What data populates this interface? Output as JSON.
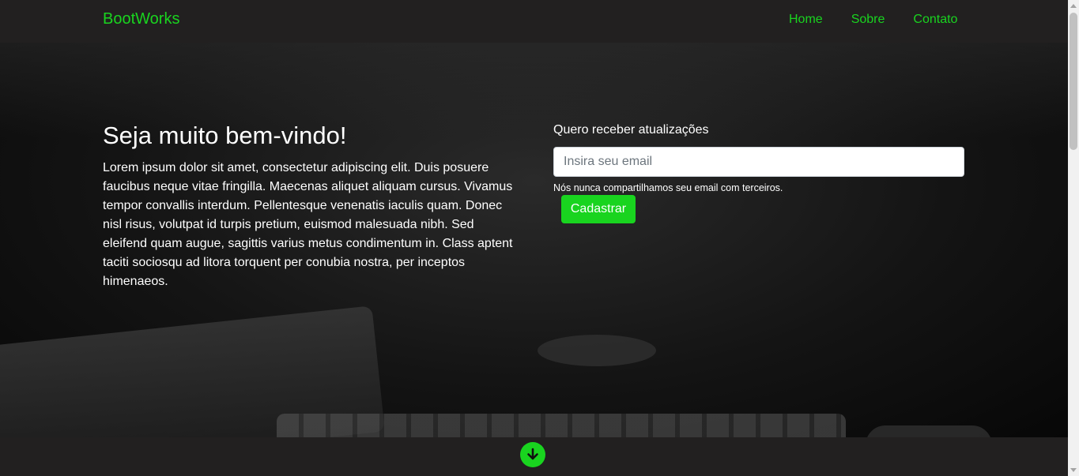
{
  "navbar": {
    "brand": "BootWorks",
    "links": [
      "Home",
      "Sobre",
      "Contato"
    ]
  },
  "hero": {
    "title": "Seja muito bem-vindo!",
    "text": "Lorem ipsum dolor sit amet, consectetur adipiscing elit. Duis posuere faucibus neque vitae fringilla. Maecenas aliquet aliquam cursus. Vivamus tempor convallis interdum. Pellentesque venenatis iaculis quam. Donec nisl risus, volutpat id turpis pretium, euismod malesuada nibh. Sed eleifend quam augue, sagittis varius metus condimentum in. Class aptent taciti sociosqu ad litora torquent per conubia nostra, per inceptos himenaeos."
  },
  "form": {
    "label": "Quero receber atualizações",
    "email_placeholder": "Insira seu email",
    "email_value": "",
    "help": "Nós nunca compartilhamos seu email com terceiros.",
    "submit_label": "Cadastrar"
  },
  "footer": {
    "icon": "arrow-down-circle-icon"
  },
  "colors": {
    "accent": "#19d41f",
    "navbar_bg": "#222020"
  }
}
